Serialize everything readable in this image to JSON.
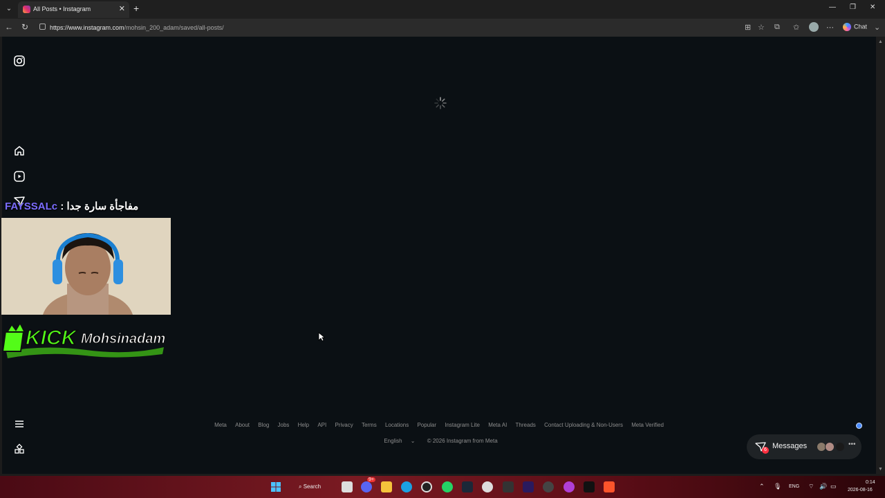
{
  "browser": {
    "tab_title": "All Posts • Instagram",
    "url_host": "https://www.instagram.com",
    "url_path": "/mohsin_200_adam/saved/all-posts/",
    "chat_label": "Chat"
  },
  "sidebar": {
    "icons": [
      "instagram-logo-icon",
      "home-icon",
      "reels-icon",
      "messages-icon",
      "menu-icon",
      "more-apps-icon"
    ]
  },
  "footer": {
    "links": [
      "Meta",
      "About",
      "Blog",
      "Jobs",
      "Help",
      "API",
      "Privacy",
      "Terms",
      "Locations",
      "Popular",
      "Instagram Lite",
      "Meta AI",
      "Threads",
      "Contact Uploading & Non-Users",
      "Meta Verified"
    ],
    "language": "English",
    "copyright": "© 2026 Instagram from Meta"
  },
  "messages": {
    "label": "Messages",
    "badge": "6"
  },
  "overlay": {
    "username": "FAYSSALc",
    "message": " : مفاجأة سارة جدا",
    "banner_kick": "KICK",
    "banner_name": "Mohsinadam"
  },
  "taskbar": {
    "search_label": "Search",
    "language": "ENG",
    "time": "0:14",
    "date": "2026-08-16",
    "discord_badge": "9+"
  }
}
